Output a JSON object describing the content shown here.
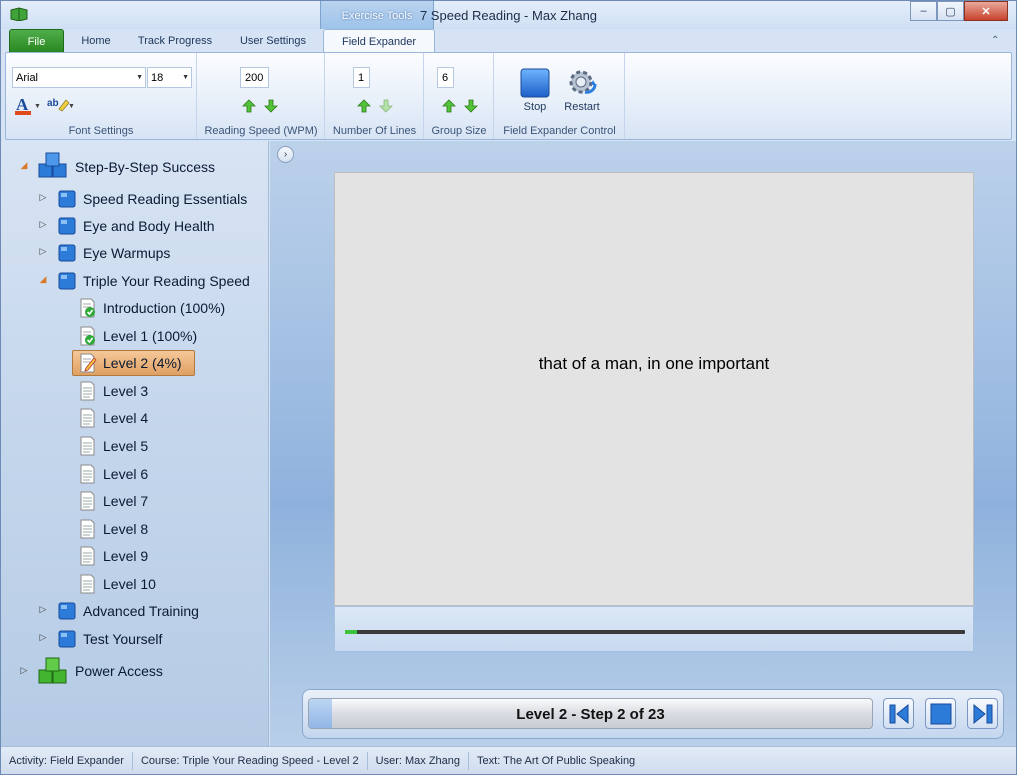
{
  "window": {
    "title": "7 Speed Reading - Max Zhang",
    "context_tab_header": "Exercise Tools",
    "controls": [
      "–",
      "▢",
      "✕"
    ]
  },
  "tabs": [
    {
      "label": "File"
    },
    {
      "label": "Home"
    },
    {
      "label": "Track Progress"
    },
    {
      "label": "User Settings"
    },
    {
      "label": "Field Expander",
      "active": true
    }
  ],
  "ribbon": {
    "font_settings": {
      "font": "Arial",
      "size": "18",
      "label": "Font Settings"
    },
    "reading_speed": {
      "value": "200",
      "label": "Reading Speed (WPM)"
    },
    "number_of_lines": {
      "value": "1",
      "label": "Number Of Lines"
    },
    "group_size": {
      "value": "6",
      "label": "Group Size"
    },
    "control": {
      "stop": "Stop",
      "restart": "Restart",
      "label": "Field Expander Control"
    }
  },
  "tree": {
    "root": "Step-By-Step Success",
    "sections": [
      "Speed Reading Essentials",
      "Eye and Body Health",
      "Eye Warmups",
      "Triple Your Reading Speed"
    ],
    "levels": [
      "Introduction (100%)",
      "Level 1 (100%)",
      "Level 2 (4%)",
      "Level 3",
      "Level 4",
      "Level 5",
      "Level 6",
      "Level 7",
      "Level 8",
      "Level 9",
      "Level 10"
    ],
    "after": [
      "Advanced Training",
      "Test Yourself"
    ],
    "root2": "Power Access"
  },
  "reading": {
    "text": "that of a man, in one important",
    "progress": 0.02
  },
  "nav": {
    "step_text": "Level 2 - Step 2 of 23",
    "step_progress": 0.04
  },
  "status": {
    "activity": "Activity: Field Expander",
    "course": "Course: Triple Your Reading Speed - Level 2",
    "user": "User: Max Zhang",
    "text": "Text: The Art Of Public Speaking"
  },
  "colors": {
    "accent": "#2d7bd8",
    "selected": "#e8ad6f",
    "file_tab": "#2e8b25"
  }
}
